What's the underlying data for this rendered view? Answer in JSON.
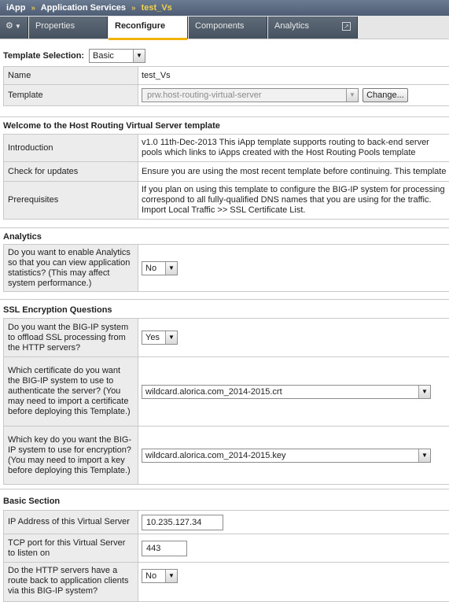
{
  "breadcrumb": {
    "items": [
      "iApp",
      "Application Services",
      "test_Vs"
    ],
    "separator": "»"
  },
  "tabs": [
    {
      "label": "Properties"
    },
    {
      "label": "Reconfigure"
    },
    {
      "label": "Components"
    },
    {
      "label": "Analytics"
    }
  ],
  "template_selection": {
    "label": "Template Selection:",
    "value": "Basic"
  },
  "identity": {
    "name_label": "Name",
    "name_value": "test_Vs",
    "template_label": "Template",
    "template_value": "prw.host-routing-virtual-server",
    "change_button": "Change..."
  },
  "welcome": {
    "heading": "Welcome to the Host Routing Virtual Server template",
    "rows": [
      {
        "label": "Introduction",
        "text": "v1.0 11th-Dec-2013 This iApp template supports routing to back-end server pools which links to iApps created with the Host Routing Pools template"
      },
      {
        "label": "Check for updates",
        "text": "Ensure you are using the most recent template before continuing. This template"
      },
      {
        "label": "Prerequisites",
        "text": "If you plan on using this template to configure the BIG-IP system for processing correspond to all fully-qualified DNS names that you are using for the traffic. Import Local Traffic >> SSL Certificate List."
      }
    ]
  },
  "analytics": {
    "heading": "Analytics",
    "question": "Do you want to enable Analytics so that you can view application statistics? (This may affect system performance.)",
    "value": "No"
  },
  "ssl": {
    "heading": "SSL Encryption Questions",
    "offload_question": "Do you want the BIG-IP system to offload SSL processing from the HTTP servers?",
    "offload_value": "Yes",
    "cert_question": "Which certificate do you want the BIG-IP system to use to authenticate the server? (You may need to import a certificate before deploying this Template.)",
    "cert_value": "wildcard.alorica.com_2014-2015.crt",
    "key_question": "Which key do you want the BIG-IP system to use for encryption? (You may need to import a key before deploying this Template.)",
    "key_value": "wildcard.alorica.com_2014-2015.key"
  },
  "basic": {
    "heading": "Basic Section",
    "ip_label": "IP Address of this Virtual Server",
    "ip_value": "10.235.127.34",
    "port_label": "TCP port for this Virtual Server to listen on",
    "port_value": "443",
    "route_label": "Do the HTTP servers have a route back to application clients via this BIG-IP system?",
    "route_value": "No"
  }
}
